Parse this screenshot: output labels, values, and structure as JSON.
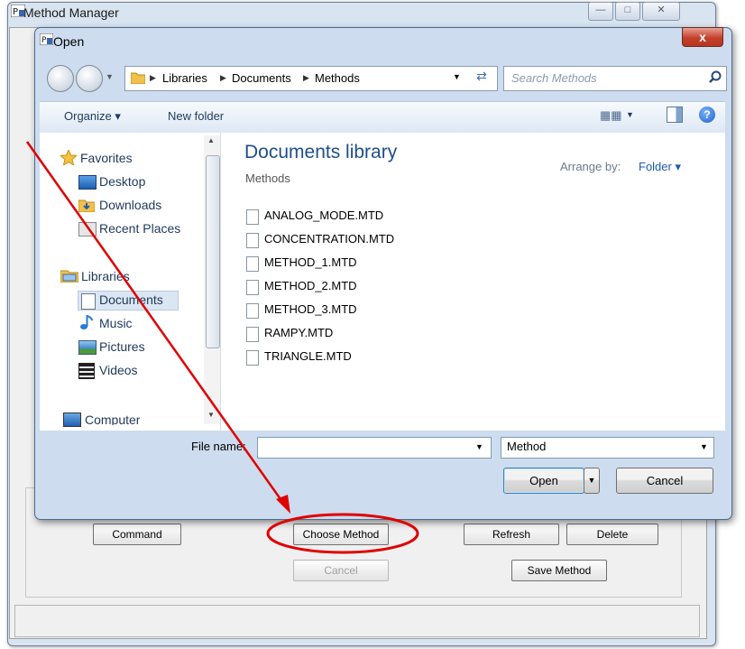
{
  "method_manager": {
    "title": "Method Manager",
    "buttons": {
      "command": "Command",
      "choose_method": "Choose Method",
      "refresh": "Refresh",
      "delete": "Delete",
      "cancel": "Cancel",
      "save_method": "Save Method"
    }
  },
  "open_dialog": {
    "title": "Open",
    "close_label": "x",
    "breadcrumb": [
      "Libraries",
      "Documents",
      "Methods"
    ],
    "search_placeholder": "Search Methods",
    "toolbar": {
      "organize": "Organize ▾",
      "new_folder": "New folder"
    },
    "nav": {
      "favorites": "Favorites",
      "desktop": "Desktop",
      "downloads": "Downloads",
      "recent_places": "Recent Places",
      "libraries": "Libraries",
      "documents": "Documents",
      "music": "Music",
      "pictures": "Pictures",
      "videos": "Videos",
      "computer": "Computer"
    },
    "library_title": "Documents library",
    "library_subtitle": "Methods",
    "arrange_by_label": "Arrange by:",
    "arrange_by_value": "Folder ▾",
    "files": [
      "ANALOG_MODE.MTD",
      "CONCENTRATION.MTD",
      "METHOD_1.MTD",
      "METHOD_2.MTD",
      "METHOD_3.MTD",
      "RAMPY.MTD",
      "TRIANGLE.MTD"
    ],
    "file_name_label": "File name:",
    "file_name_value": "",
    "file_type": "Method",
    "open_button": "Open",
    "cancel_button": "Cancel"
  },
  "colors": {
    "annotation": "#e00000",
    "library_title": "#1e4e8c"
  }
}
